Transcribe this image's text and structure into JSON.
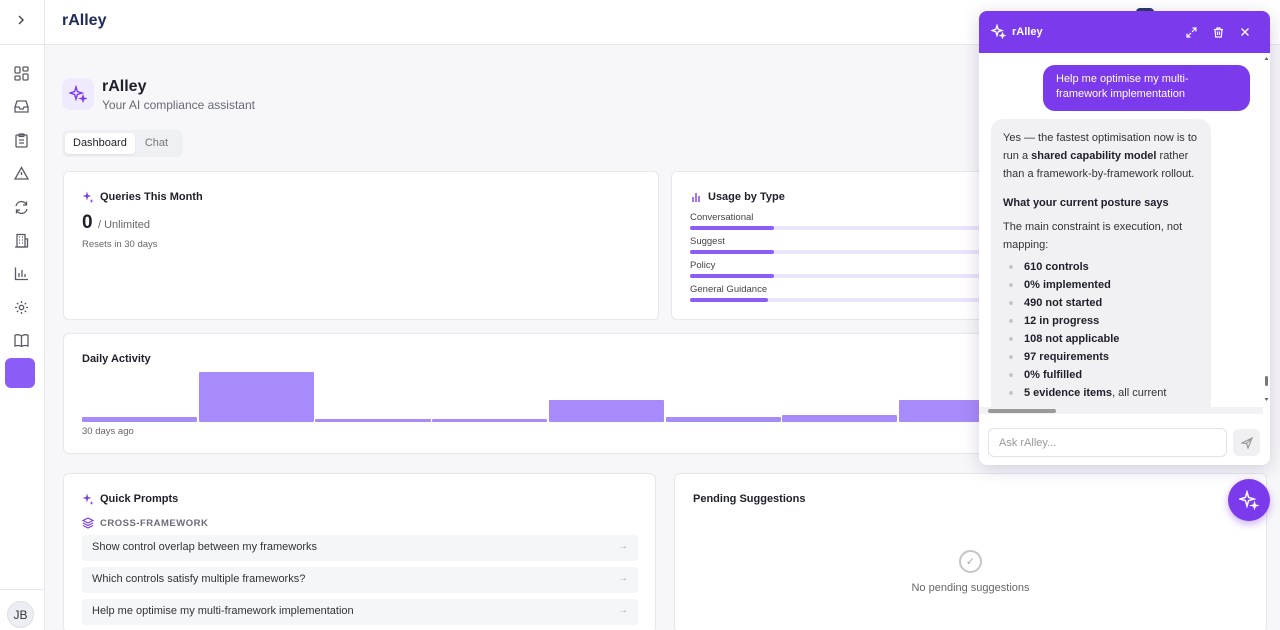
{
  "app": {
    "title": "rAlley",
    "user_initials": "JB"
  },
  "sidebar": {
    "icons": [
      "dashboard-icon",
      "inbox-icon",
      "clipboard-icon",
      "alert-icon",
      "refresh-icon",
      "building-icon",
      "chart-icon",
      "settings-icon",
      "book-icon",
      "ai-active-icon"
    ]
  },
  "header": {
    "title": "rAlley",
    "subtitle": "Your AI compliance assistant"
  },
  "tabs": [
    {
      "label": "Dashboard",
      "active": true
    },
    {
      "label": "Chat",
      "active": false
    }
  ],
  "queries": {
    "title": "Queries This Month",
    "count": "0",
    "limit": "/ Unlimited",
    "note": "Resets in 30 days"
  },
  "usage": {
    "title": "Usage by Type",
    "rows": [
      {
        "label": "Conversational",
        "fraction": 0.28
      },
      {
        "label": "Suggest",
        "fraction": 0.28
      },
      {
        "label": "Policy",
        "fraction": 0.28
      },
      {
        "label": "General Guidance",
        "fraction": 0.26
      }
    ]
  },
  "daily_activity": {
    "title": "Daily Activity",
    "x_start_label": "30 days ago",
    "values": [
      1,
      10,
      0.5,
      0.5,
      4.5,
      1,
      1.5,
      4.5
    ]
  },
  "quick_prompts": {
    "title": "Quick Prompts",
    "section": "CROSS-FRAMEWORK",
    "items": [
      "Show control overlap between my frameworks",
      "Which controls satisfy multiple frameworks?",
      "Help me optimise my multi-framework implementation"
    ],
    "arrow": "→"
  },
  "pending": {
    "title": "Pending Suggestions",
    "empty_text": "No pending suggestions",
    "check": "✓"
  },
  "chat": {
    "title": "rAlley",
    "user_message": "Help me optimise my multi-framework implementation",
    "reply": {
      "intro_pre": "Yes — the fastest optimisation now is to run a ",
      "intro_bold": "shared capability model",
      "intro_post": " rather than a framework-by-framework rollout.",
      "section_title": "What your current posture says",
      "section_intro": "The main constraint is execution, not mapping:",
      "items": [
        {
          "bold": "610 controls",
          "rest": ""
        },
        {
          "bold": "0% implemented",
          "rest": ""
        },
        {
          "bold": "490 not started",
          "rest": ""
        },
        {
          "bold": "12 in progress",
          "rest": ""
        },
        {
          "bold": "108 not applicable",
          "rest": ""
        },
        {
          "bold": "97 requirements",
          "rest": ""
        },
        {
          "bold": "0% fulfilled",
          "rest": ""
        },
        {
          "bold": "5 evidence items",
          "rest": ", all current"
        }
      ]
    },
    "input_placeholder": "Ask rAlley..."
  },
  "colors": {
    "accent": "#7c3aed",
    "bar": "#a78bfa",
    "track": "#ebe5fb"
  }
}
